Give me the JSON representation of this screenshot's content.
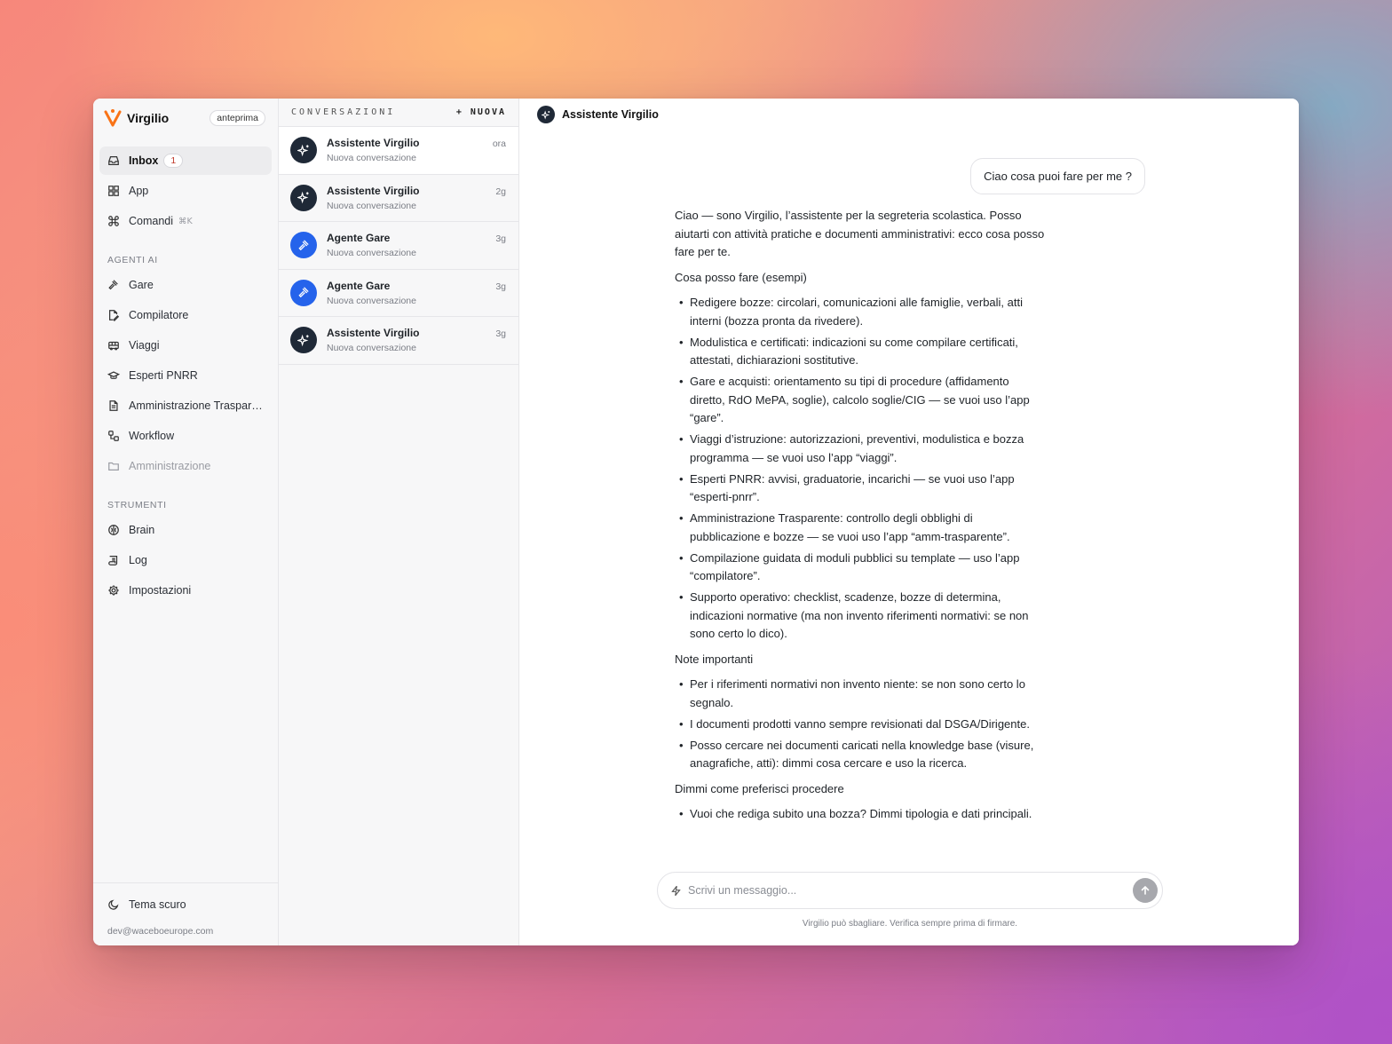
{
  "brand": {
    "name": "Virgilio",
    "badge": "anteprima"
  },
  "nav": {
    "main": [
      {
        "label": "Inbox",
        "count": "1",
        "icon": "inbox-icon"
      },
      {
        "label": "App",
        "icon": "grid-icon"
      },
      {
        "label": "Comandi",
        "shortcut": "⌘K",
        "icon": "command-icon"
      }
    ],
    "agents_title": "AGENTI AI",
    "agents": [
      {
        "label": "Gare",
        "icon": "gavel-icon"
      },
      {
        "label": "Compilatore",
        "icon": "file-edit-icon"
      },
      {
        "label": "Viaggi",
        "icon": "bus-icon"
      },
      {
        "label": "Esperti PNRR",
        "icon": "graduation-cap-icon"
      },
      {
        "label": "Amministrazione Trasparente",
        "icon": "document-icon"
      },
      {
        "label": "Workflow",
        "icon": "workflow-icon"
      },
      {
        "label": "Amministrazione",
        "icon": "folder-icon"
      }
    ],
    "tools_title": "STRUMENTI",
    "tools": [
      {
        "label": "Brain",
        "icon": "brain-icon"
      },
      {
        "label": "Log",
        "icon": "scroll-icon"
      },
      {
        "label": "Impostazioni",
        "icon": "gear-icon"
      }
    ],
    "theme_label": "Tema scuro",
    "user_email": "dev@waceboeurope.com"
  },
  "conversations": {
    "title": "CONVERSAZIONI",
    "new_label": "+ NUOVA",
    "items": [
      {
        "title": "Assistente Virgilio",
        "subtitle": "Nuova conversazione",
        "time": "ora",
        "avatar": "sparkles-icon"
      },
      {
        "title": "Assistente Virgilio",
        "subtitle": "Nuova conversazione",
        "time": "2g",
        "avatar": "sparkles-icon"
      },
      {
        "title": "Agente Gare",
        "subtitle": "Nuova conversazione",
        "time": "3g",
        "avatar": "gavel-icon"
      },
      {
        "title": "Agente Gare",
        "subtitle": "Nuova conversazione",
        "time": "3g",
        "avatar": "gavel-icon"
      },
      {
        "title": "Assistente Virgilio",
        "subtitle": "Nuova conversazione",
        "time": "3g",
        "avatar": "sparkles-icon"
      }
    ]
  },
  "chat": {
    "title": "Assistente Virgilio",
    "user_message": "Ciao cosa puoi fare per me ?",
    "answer": {
      "intro": "Ciao — sono Virgilio, l’assistente per la segreteria scolastica. Posso aiutarti con attività pratiche e documenti amministrativi: ecco cosa posso fare per te.",
      "section1_title": "Cosa posso fare (esempi)",
      "section1_items": [
        "Redigere bozze: circolari, comunicazioni alle famiglie, verbali, atti interni (bozza pronta da rivedere).",
        "Modulistica e certificati: indicazioni su come compilare certificati, attestati, dichiarazioni sostitutive.",
        "Gare e acquisti: orientamento su tipi di procedure (affidamento diretto, RdO MePA, soglie), calcolo soglie/CIG — se vuoi uso l’app “gare”.",
        "Viaggi d’istruzione: autorizzazioni, preventivi, modulistica e bozza programma — se vuoi uso l’app “viaggi”.",
        "Esperti PNRR: avvisi, graduatorie, incarichi — se vuoi uso l’app “esperti-pnrr”.",
        "Amministrazione Trasparente: controllo degli obblighi di pubblicazione e bozze — se vuoi uso l’app “amm-trasparente”.",
        "Compilazione guidata di moduli pubblici su template — uso l’app “compilatore”.",
        "Supporto operativo: checklist, scadenze, bozze di determina, indicazioni normative (ma non invento riferimenti normativi: se non sono certo lo dico)."
      ],
      "section2_title": "Note importanti",
      "section2_items": [
        "Per i riferimenti normativi non invento niente: se non sono certo lo segnalo.",
        "I documenti prodotti vanno sempre revisionati dal DSGA/Dirigente.",
        "Posso cercare nei documenti caricati nella knowledge base (visure, anagrafiche, atti): dimmi cosa cercare e uso la ricerca."
      ],
      "section3_title": "Dimmi come preferisci procedere",
      "section3_items": [
        "Vuoi che rediga subito una bozza? Dimmi tipologia e dati principali."
      ]
    },
    "composer_placeholder": "Scrivi un messaggio...",
    "disclaimer": "Virgilio può sbagliare. Verifica sempre prima di firmare."
  },
  "colors": {
    "accent_orange": "#f97316",
    "avatar_dark": "#1f2937",
    "avatar_blue": "#2563eb",
    "inbox_count": "#c0392b"
  }
}
